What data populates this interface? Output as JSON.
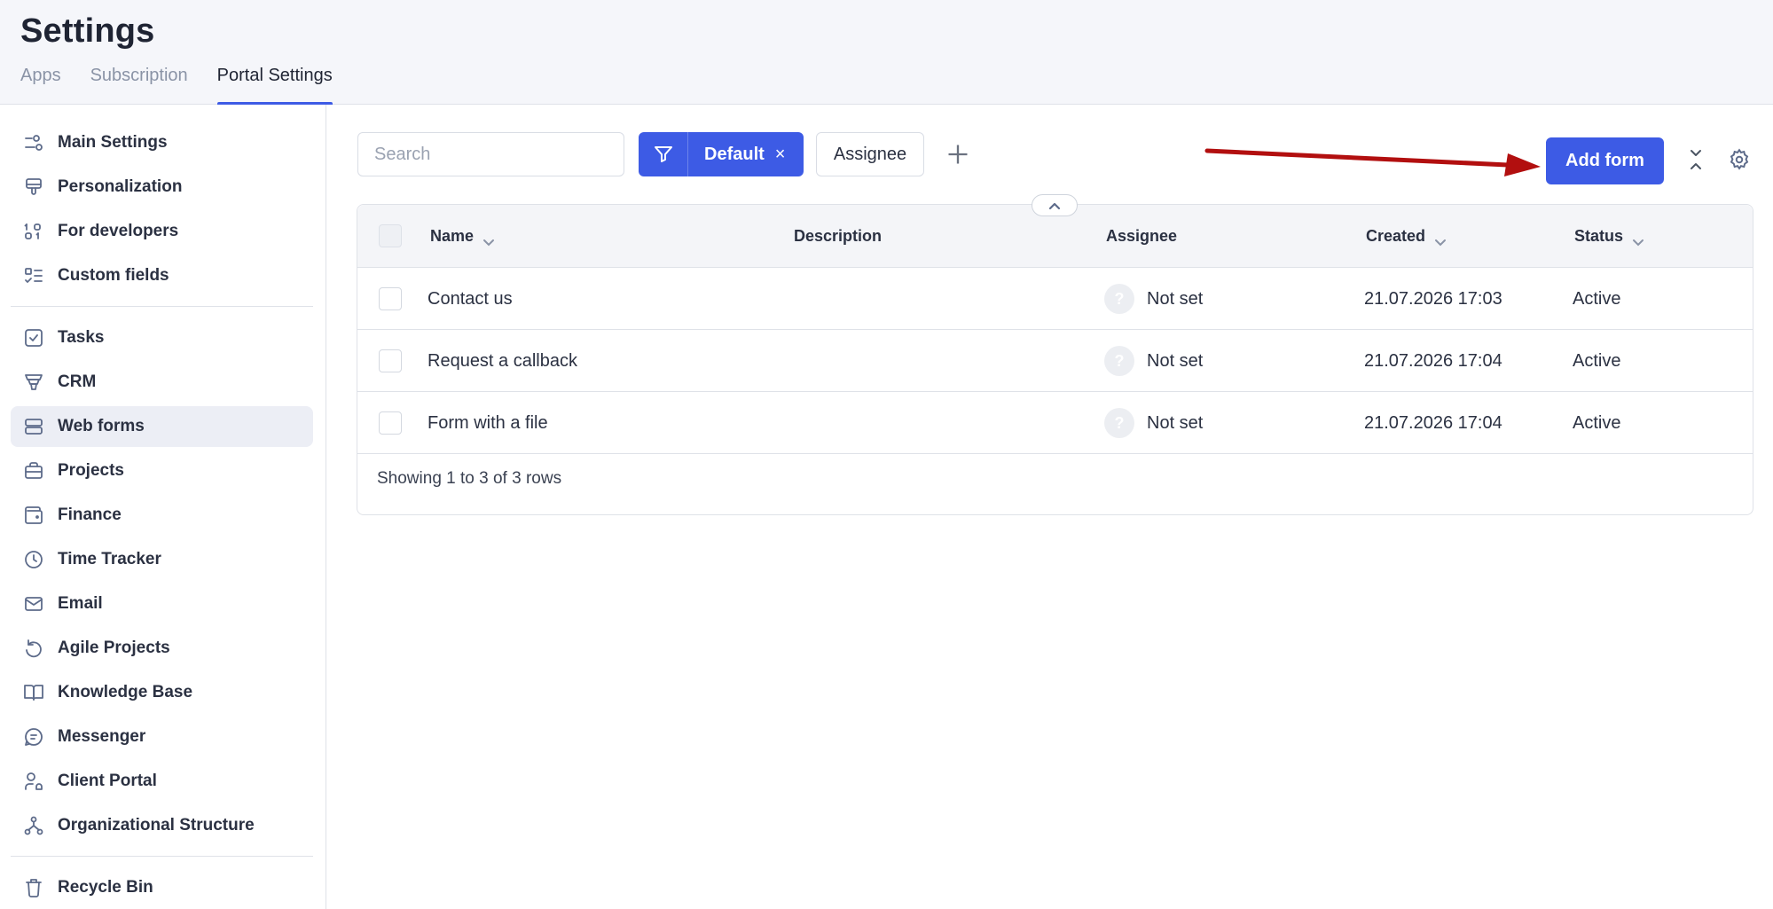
{
  "header": {
    "title": "Settings",
    "tabs": [
      {
        "label": "Apps",
        "active": false
      },
      {
        "label": "Subscription",
        "active": false
      },
      {
        "label": "Portal Settings",
        "active": true
      }
    ]
  },
  "sidebar": {
    "items": [
      {
        "label": "Main Settings",
        "icon": "sliders-icon"
      },
      {
        "label": "Personalization",
        "icon": "paint-brush-icon"
      },
      {
        "label": "For developers",
        "icon": "binary-code-icon"
      },
      {
        "label": "Custom fields",
        "icon": "checklist-icon"
      },
      {
        "label": "Tasks",
        "icon": "checkbox-icon"
      },
      {
        "label": "CRM",
        "icon": "funnel-icon"
      },
      {
        "label": "Web forms",
        "icon": "form-icon",
        "active": true
      },
      {
        "label": "Projects",
        "icon": "briefcase-icon"
      },
      {
        "label": "Finance",
        "icon": "wallet-icon"
      },
      {
        "label": "Time Tracker",
        "icon": "clock-icon"
      },
      {
        "label": "Email",
        "icon": "mail-icon"
      },
      {
        "label": "Agile Projects",
        "icon": "refresh-icon"
      },
      {
        "label": "Knowledge Base",
        "icon": "book-icon"
      },
      {
        "label": "Messenger",
        "icon": "chat-icon"
      },
      {
        "label": "Client Portal",
        "icon": "users-icon"
      },
      {
        "label": "Organizational Structure",
        "icon": "org-chart-icon"
      },
      {
        "label": "Recycle Bin",
        "icon": "trash-icon"
      }
    ]
  },
  "toolbar": {
    "search_placeholder": "Search",
    "filter_label": "Default",
    "filter_close": "×",
    "assignee_label": "Assignee",
    "add_form_label": "Add form"
  },
  "table": {
    "columns": {
      "name": "Name",
      "description": "Description",
      "assignee": "Assignee",
      "created": "Created",
      "status": "Status"
    },
    "rows": [
      {
        "name": "Contact us",
        "description": "",
        "assignee": "Not set",
        "created": "21.07.2026 17:03",
        "status": "Active"
      },
      {
        "name": "Request a callback",
        "description": "",
        "assignee": "Not set",
        "created": "21.07.2026 17:04",
        "status": "Active"
      },
      {
        "name": "Form with a file",
        "description": "",
        "assignee": "Not set",
        "created": "21.07.2026 17:04",
        "status": "Active"
      }
    ],
    "avatar_glyph": "?",
    "footer": "Showing 1 to 3 of 3 rows"
  },
  "colors": {
    "accent": "#3d5be5",
    "annotation_arrow": "#b20f0f"
  }
}
